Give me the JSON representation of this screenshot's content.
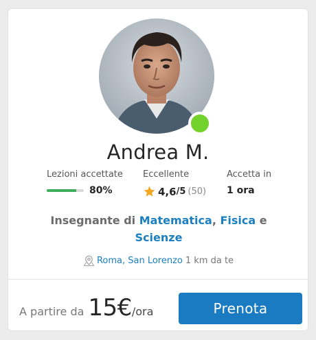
{
  "teacher": {
    "name": "Andrea M.",
    "online": true
  },
  "stats": {
    "lessons": {
      "label": "Lezioni accettate",
      "value": "80%",
      "progress": 0.8
    },
    "rating": {
      "label": "Eccellente",
      "score": "4,6",
      "scale": "/5",
      "reviews": "(50)"
    },
    "response": {
      "label": "Accetta in",
      "value": "1 ora"
    }
  },
  "subjects": {
    "prefix": "Insegnante di",
    "items": [
      "Matematica",
      "Fisica",
      "Scienze"
    ],
    "separator": ",",
    "conjunction": "e"
  },
  "location": {
    "place": "Roma, San Lorenzo",
    "distance": "1 km da te"
  },
  "price": {
    "prefix": "A partire da",
    "amount": "15€",
    "unit": "/ora"
  },
  "actions": {
    "book_label": "Prenota"
  },
  "colors": {
    "accent": "#1a7bc2",
    "link": "#1b7fc0",
    "online": "#72d12a",
    "progress": "#3fae5a",
    "star": "#f5a623"
  },
  "icons": {
    "rating": "star-icon",
    "location": "map-pin-icon"
  }
}
